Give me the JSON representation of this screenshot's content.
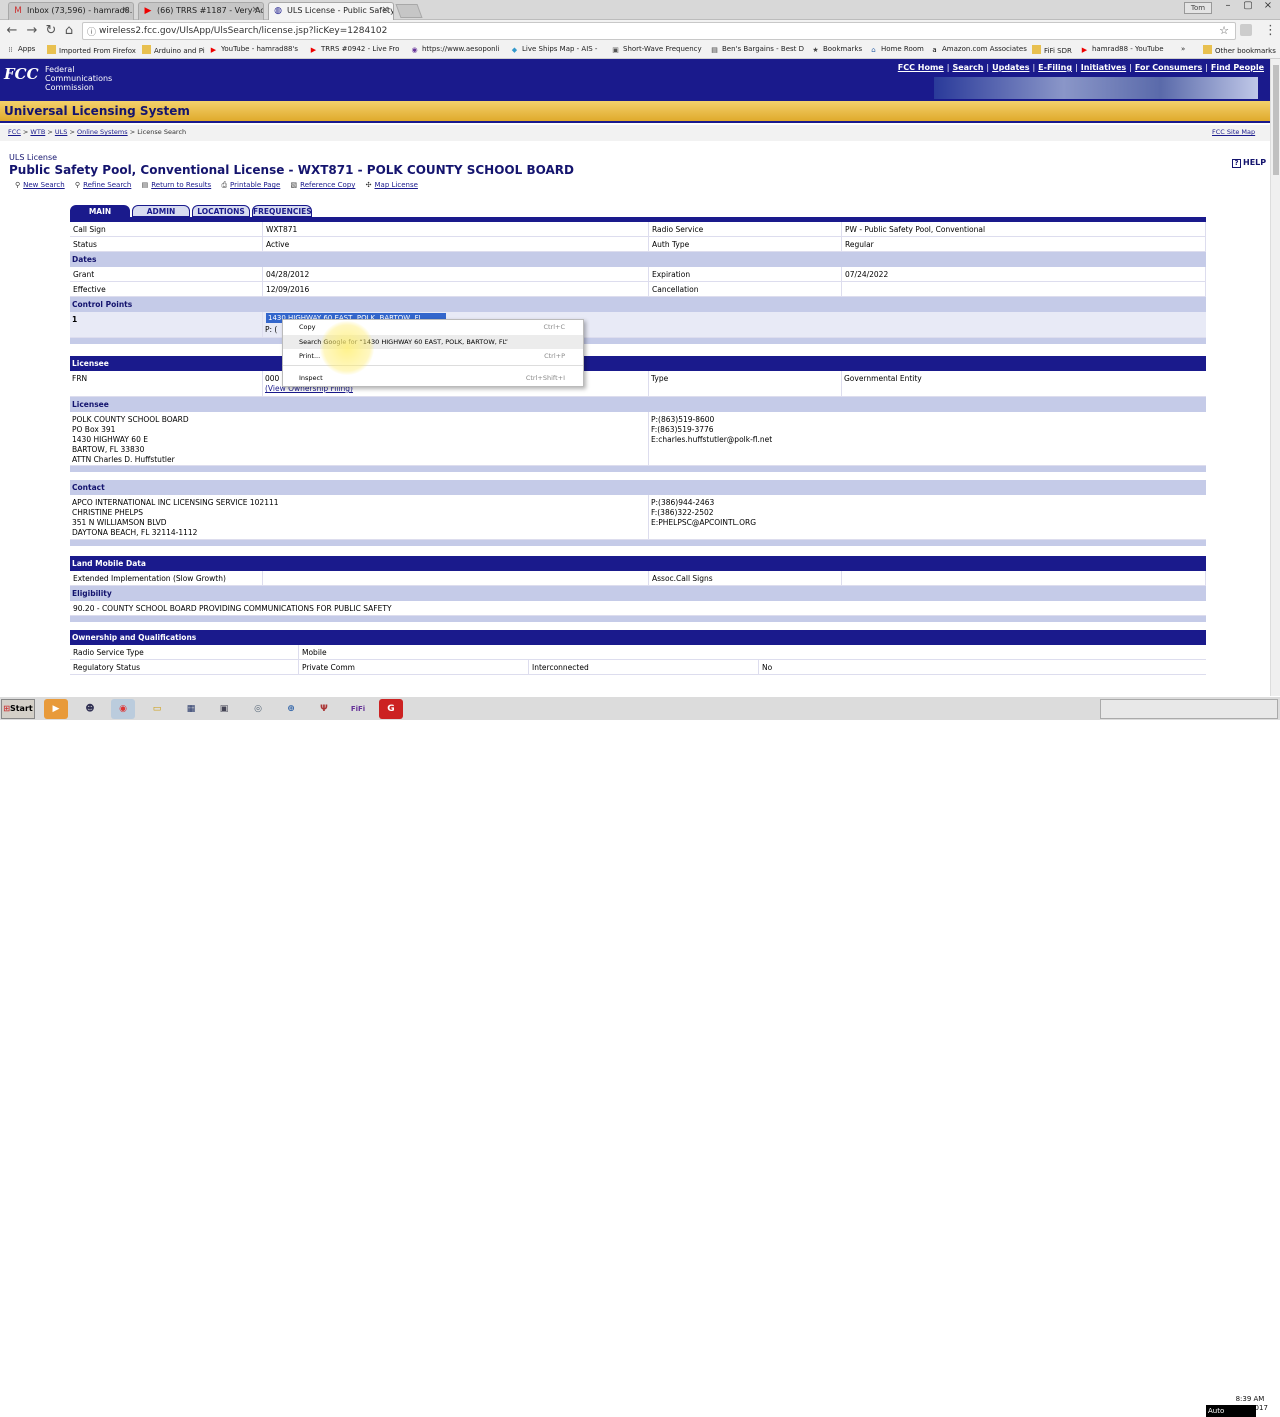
{
  "browser": {
    "tabs": [
      {
        "icon": "gmail-icon",
        "label": "Inbox (73,596) - hamrad8..."
      },
      {
        "icon": "youtube-icon",
        "label": "(66) TRRS #1187 - Very Ac..."
      },
      {
        "icon": "fcc-icon",
        "label": "ULS License - Public Safety..."
      }
    ],
    "user": "Tom",
    "url": "wireless2.fcc.gov/UlsApp/UlsSearch/license.jsp?licKey=1284102",
    "bookmarks": [
      "Apps",
      "Imported From Firefox",
      "Arduino and Pi",
      "YouTube - hamrad88's",
      "TRRS #0942 - Live Fro",
      "https://www.aesoponli",
      "Live Ships Map - AIS -",
      "Short-Wave Frequency",
      "Ben's Bargains - Best D",
      "Bookmarks",
      "Home Room",
      "Amazon.com Associates",
      "FiFi SDR",
      "hamrad88 - YouTube",
      "Other bookmarks"
    ]
  },
  "fcc": {
    "logo": "FCC",
    "agency_line1": "Federal",
    "agency_line2": "Communications",
    "agency_line3": "Commission",
    "top_links": [
      "FCC Home",
      "Search",
      "Updates",
      "E-Filing",
      "Initiatives",
      "For Consumers",
      "Find People"
    ],
    "system_title": "Universal Licensing System",
    "breadcrumb": [
      "FCC",
      "WTB",
      "ULS",
      "Online Systems",
      "License Search"
    ],
    "site_map": "FCC Site Map"
  },
  "license": {
    "kind": "ULS License",
    "title": "Public Safety Pool, Conventional License - WXT871 - POLK COUNTY SCHOOL BOARD",
    "help": "HELP",
    "actions": [
      "New Search",
      "Refine Search",
      "Return to Results",
      "Printable Page",
      "Reference Copy",
      "Map License"
    ],
    "subtabs": [
      "MAIN",
      "ADMIN",
      "LOCATIONS",
      "FREQUENCIES"
    ],
    "call_sign_label": "Call Sign",
    "call_sign": "WXT871",
    "radio_service_label": "Radio Service",
    "radio_service": "PW - Public Safety Pool, Conventional",
    "status_label": "Status",
    "status": "Active",
    "auth_type_label": "Auth Type",
    "auth_type": "Regular",
    "dates_header": "Dates",
    "grant_label": "Grant",
    "grant": "04/28/2012",
    "expiration_label": "Expiration",
    "expiration": "07/24/2022",
    "effective_label": "Effective",
    "effective": "12/09/2016",
    "cancellation_label": "Cancellation",
    "cancellation": "",
    "control_points_header": "Control Points",
    "cp_number": "1",
    "cp_address_selected": "1430 HIGHWAY 60 EAST, POLK, BARTOW, FL",
    "cp_phone": "P: (",
    "licensee_band": "Licensee",
    "frn_label": "FRN",
    "frn": "000",
    "ownership_link": "(View Ownership Filing)",
    "type_label": "Type",
    "type": "Governmental Entity",
    "licensee_header": "Licensee",
    "licensee_lines": [
      "POLK COUNTY SCHOOL BOARD",
      "PO Box 391",
      "1430 HIGHWAY 60 E",
      "BARTOW, FL 33830",
      "ATTN Charles D. Huffstutler"
    ],
    "licensee_contact": [
      "P:(863)519-8600",
      "F:(863)519-3776",
      "E:charles.huffstutler@polk-fl.net"
    ],
    "contact_header": "Contact",
    "contact_lines": [
      "APCO INTERNATIONAL INC LICENSING SERVICE 102111",
      "CHRISTINE PHELPS",
      "351 N WILLIAMSON BLVD",
      "DAYTONA BEACH, FL 32114-1112"
    ],
    "contact_contact": [
      "P:(386)944-2463",
      "F:(386)322-2502",
      "E:PHELPSC@APCOINTL.ORG"
    ],
    "land_mobile_header": "Land Mobile Data",
    "ext_impl_label": "Extended Implementation (Slow Growth)",
    "ext_impl": "",
    "assoc_label": "Assoc.Call Signs",
    "assoc": "",
    "eligibility_header": "Eligibility",
    "eligibility": "90.20 - COUNTY SCHOOL BOARD PROVIDING COMMUNICATIONS FOR PUBLIC SAFETY",
    "ownership_header": "Ownership and Qualifications",
    "radio_service_type_label": "Radio Service Type",
    "radio_service_type": "Mobile",
    "regulatory_label": "Regulatory Status",
    "regulatory": "Private Comm",
    "interconnected_label": "Interconnected",
    "interconnected": "No"
  },
  "context_menu": {
    "items": [
      {
        "label": "Copy",
        "shortcut": "Ctrl+C"
      },
      {
        "label": "Search Google for “1430 HIGHWAY 60 EAST, POLK, BARTOW, FL”",
        "shortcut": ""
      },
      {
        "label": "Print...",
        "shortcut": "Ctrl+P"
      },
      {
        "label": "Inspect",
        "shortcut": "Ctrl+Shift+I"
      }
    ]
  },
  "taskbar": {
    "start": "Start",
    "clock_time": "8:39 AM",
    "clock_date": "4/28/2017",
    "auto_label": "Auto"
  }
}
